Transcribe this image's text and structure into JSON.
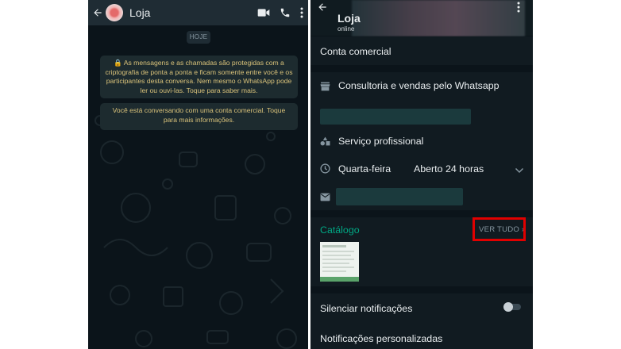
{
  "left_chat": {
    "contact_name": "Loja",
    "date_chip": "HOJE",
    "encryption_notice": "🔒 As mensagens e as chamadas são protegidas com a criptografia de ponta a ponta e ficam somente entre você e os participantes desta conversa. Nem mesmo o WhatsApp pode ler ou ouvi-las. Toque para saber mais.",
    "business_notice": "Você está conversando com uma conta comercial. Toque para mais informações.",
    "icons": [
      "back-arrow-icon",
      "video-call-icon",
      "phone-call-icon",
      "more-options-icon"
    ]
  },
  "right_profile": {
    "contact_name": "Loja",
    "status": "online",
    "account_type": "Conta comercial",
    "category": "Consultoria e vendas pelo Whatsapp",
    "service": "Serviço profissional",
    "hours_day": "Quarta-feira",
    "hours_value": "Aberto 24 horas",
    "catalog_label": "Catálogo",
    "see_all": "VER TUDO",
    "mute_notifications": "Silenciar notificações",
    "mute_enabled": false,
    "custom_notifications": "Notificações personalizadas",
    "icons": [
      "back-arrow-icon",
      "more-options-icon",
      "store-icon",
      "shapes-icon",
      "clock-icon",
      "chevron-down-icon",
      "email-icon",
      "chevron-right-icon"
    ]
  },
  "colors": {
    "accent": "#00a884",
    "highlight_box": "#e10000",
    "system_text": "#d9c27a",
    "background": "#0b141a"
  }
}
